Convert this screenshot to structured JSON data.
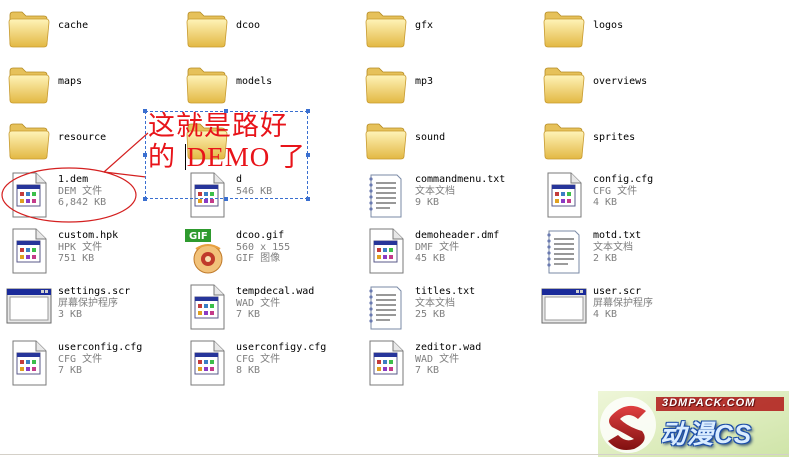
{
  "items": [
    {
      "icon": "folder",
      "name": "cache",
      "meta1": "",
      "meta2": ""
    },
    {
      "icon": "folder",
      "name": "dcoo",
      "meta1": "",
      "meta2": ""
    },
    {
      "icon": "folder",
      "name": "gfx",
      "meta1": "",
      "meta2": ""
    },
    {
      "icon": "folder",
      "name": "logos",
      "meta1": "",
      "meta2": ""
    },
    {
      "icon": "folder",
      "name": "maps",
      "meta1": "",
      "meta2": ""
    },
    {
      "icon": "folder",
      "name": "models",
      "meta1": "",
      "meta2": ""
    },
    {
      "icon": "folder",
      "name": "mp3",
      "meta1": "",
      "meta2": ""
    },
    {
      "icon": "folder",
      "name": "overviews",
      "meta1": "",
      "meta2": ""
    },
    {
      "icon": "folder",
      "name": "resource",
      "meta1": "",
      "meta2": ""
    },
    {
      "icon": "folder",
      "name": "",
      "meta1": "",
      "meta2": ""
    },
    {
      "icon": "folder",
      "name": "sound",
      "meta1": "",
      "meta2": ""
    },
    {
      "icon": "folder",
      "name": "sprites",
      "meta1": "",
      "meta2": ""
    },
    {
      "icon": "generic",
      "name": "1.dem",
      "meta1": "DEM 文件",
      "meta2": "6,842 KB"
    },
    {
      "icon": "generic",
      "name": "d",
      "meta1": "",
      "meta2": "546 KB"
    },
    {
      "icon": "text",
      "name": "commandmenu.txt",
      "meta1": "文本文档",
      "meta2": "9 KB"
    },
    {
      "icon": "generic",
      "name": "config.cfg",
      "meta1": "CFG 文件",
      "meta2": "4 KB"
    },
    {
      "icon": "generic",
      "name": "custom.hpk",
      "meta1": "HPK 文件",
      "meta2": "751 KB"
    },
    {
      "icon": "gif",
      "name": "dcoo.gif",
      "meta1": "560 x 155",
      "meta2": "GIF 图像"
    },
    {
      "icon": "generic",
      "name": "demoheader.dmf",
      "meta1": "DMF 文件",
      "meta2": "45 KB"
    },
    {
      "icon": "text",
      "name": "motd.txt",
      "meta1": "文本文档",
      "meta2": "2 KB"
    },
    {
      "icon": "screensaver",
      "name": "settings.scr",
      "meta1": "屏幕保护程序",
      "meta2": "3 KB"
    },
    {
      "icon": "generic",
      "name": "tempdecal.wad",
      "meta1": "WAD 文件",
      "meta2": "7 KB"
    },
    {
      "icon": "text",
      "name": "titles.txt",
      "meta1": "文本文档",
      "meta2": "25 KB"
    },
    {
      "icon": "screensaver",
      "name": "user.scr",
      "meta1": "屏幕保护程序",
      "meta2": "4 KB"
    },
    {
      "icon": "generic",
      "name": "userconfig.cfg",
      "meta1": "CFG 文件",
      "meta2": "7 KB"
    },
    {
      "icon": "generic",
      "name": "userconfigy.cfg",
      "meta1": "CFG 文件",
      "meta2": "8 KB"
    },
    {
      "icon": "generic",
      "name": "zeditor.wad",
      "meta1": "WAD 文件",
      "meta2": "7 KB"
    }
  ],
  "annotation": {
    "line1": "这就是路好",
    "line2_a": "的 ",
    "line2_b": "DEMO 了",
    "color": "#e8141a"
  },
  "watermark": {
    "url": "3DMPACK.COM",
    "logo_text": "动漫CS"
  }
}
